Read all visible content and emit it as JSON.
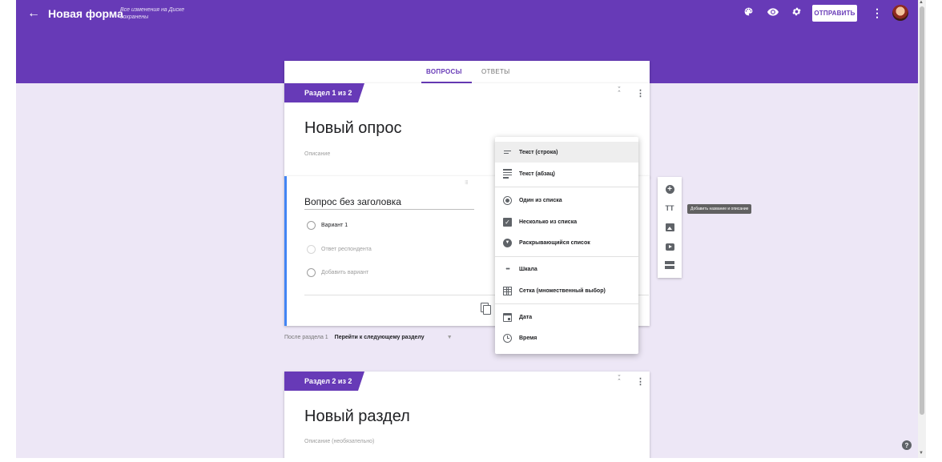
{
  "header": {
    "form_title": "Новая форма",
    "save_status": "Все изменения на Диске сохранены",
    "send_label": "ОТПРАВИТЬ"
  },
  "icons": {
    "back": "arrow-left-icon",
    "palette": "palette-icon",
    "preview": "eye-icon",
    "settings": "gear-icon",
    "more": "kebab-icon"
  },
  "tabs": {
    "questions": "ВОПРОСЫ",
    "responses": "ОТВЕТЫ"
  },
  "sections": [
    {
      "label": "Раздел 1 из 2",
      "title": "Новый опрос",
      "description_placeholder": "Описание"
    },
    {
      "label": "Раздел 2 из 2",
      "title": "Новый раздел",
      "description_placeholder": "Описание (необязательно)"
    }
  ],
  "question": {
    "title": "Вопрос без заголовка",
    "options": [
      "Вариант 1"
    ],
    "other_option": "Ответ респондента",
    "add_option": "Добавить вариант"
  },
  "after_section": {
    "label": "После раздела 1",
    "value": "Перейти к следующему разделу"
  },
  "type_menu": {
    "items": [
      "Текст (строка)",
      "Текст (абзац)",
      "Один из списка",
      "Несколько из списка",
      "Раскрывающийся список",
      "Шкала",
      "Сетка (множественный выбор)",
      "Дата",
      "Время"
    ]
  },
  "tooltip": "Добавить название и описание",
  "colors": {
    "accent": "#673ab7",
    "background": "#ede7f6",
    "focus": "#4285f4"
  }
}
